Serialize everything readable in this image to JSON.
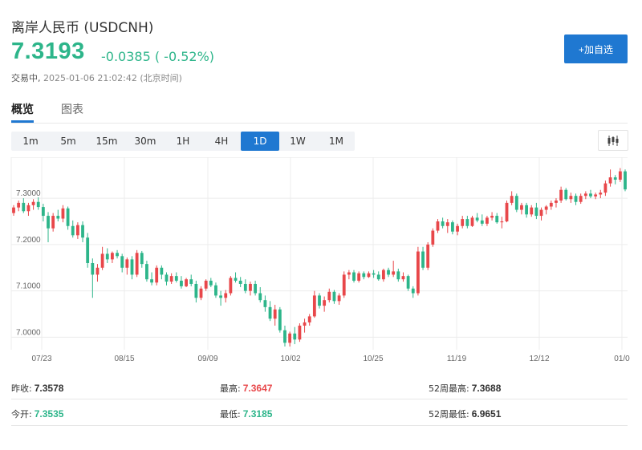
{
  "header": {
    "title": "离岸人民币  (USDCNH)",
    "price": "7.3193",
    "change": "-0.0385 ( -0.52%)",
    "status_label": "交易中,",
    "timestamp": "2025-01-06 21:02:42 (北京时间)",
    "watch_button": "+加自选"
  },
  "tabs": [
    {
      "label": "概览",
      "active": true
    },
    {
      "label": "图表",
      "active": false
    }
  ],
  "timeframes": [
    {
      "label": "1m",
      "active": false
    },
    {
      "label": "5m",
      "active": false
    },
    {
      "label": "15m",
      "active": false
    },
    {
      "label": "30m",
      "active": false
    },
    {
      "label": "1H",
      "active": false
    },
    {
      "label": "4H",
      "active": false
    },
    {
      "label": "1D",
      "active": true
    },
    {
      "label": "1W",
      "active": false
    },
    {
      "label": "1M",
      "active": false
    }
  ],
  "chart_type_icon": "candlestick-icon",
  "colors": {
    "up": "#e8474a",
    "down": "#2db58a",
    "accent": "#1f78d1",
    "grid": "#ececec"
  },
  "chart_data": {
    "type": "candlestick",
    "title": "",
    "xlabel": "",
    "ylabel": "",
    "ylim": [
      6.973,
      7.385
    ],
    "y_ticks": [
      "7.0000",
      "7.1000",
      "7.2000",
      "7.3000"
    ],
    "x_tick_labels": [
      "07/23",
      "08/15",
      "09/09",
      "10/02",
      "10/25",
      "11/19",
      "12/12",
      "01/0"
    ],
    "grid": true,
    "candles": [
      [
        7.268,
        7.285,
        7.262,
        7.28
      ],
      [
        7.28,
        7.295,
        7.272,
        7.29
      ],
      [
        7.29,
        7.3,
        7.268,
        7.272
      ],
      [
        7.272,
        7.29,
        7.262,
        7.285
      ],
      [
        7.285,
        7.298,
        7.275,
        7.292
      ],
      [
        7.292,
        7.302,
        7.275,
        7.281
      ],
      [
        7.281,
        7.288,
        7.25,
        7.262
      ],
      [
        7.262,
        7.27,
        7.205,
        7.235
      ],
      [
        7.235,
        7.268,
        7.228,
        7.262
      ],
      [
        7.262,
        7.275,
        7.25,
        7.256
      ],
      [
        7.256,
        7.285,
        7.248,
        7.278
      ],
      [
        7.278,
        7.282,
        7.232,
        7.24
      ],
      [
        7.24,
        7.252,
        7.215,
        7.22
      ],
      [
        7.22,
        7.248,
        7.212,
        7.242
      ],
      [
        7.242,
        7.25,
        7.205,
        7.215
      ],
      [
        7.215,
        7.225,
        7.15,
        7.16
      ],
      [
        7.16,
        7.17,
        7.085,
        7.135
      ],
      [
        7.135,
        7.158,
        7.12,
        7.15
      ],
      [
        7.15,
        7.195,
        7.145,
        7.18
      ],
      [
        7.18,
        7.192,
        7.16,
        7.168
      ],
      [
        7.168,
        7.185,
        7.16,
        7.182
      ],
      [
        7.182,
        7.188,
        7.17,
        7.175
      ],
      [
        7.175,
        7.18,
        7.14,
        7.15
      ],
      [
        7.15,
        7.172,
        7.135,
        7.168
      ],
      [
        7.168,
        7.175,
        7.125,
        7.135
      ],
      [
        7.135,
        7.188,
        7.13,
        7.182
      ],
      [
        7.182,
        7.186,
        7.15,
        7.158
      ],
      [
        7.158,
        7.165,
        7.12,
        7.125
      ],
      [
        7.125,
        7.14,
        7.112,
        7.118
      ],
      [
        7.118,
        7.155,
        7.112,
        7.15
      ],
      [
        7.15,
        7.155,
        7.125,
        7.135
      ],
      [
        7.135,
        7.14,
        7.112,
        7.12
      ],
      [
        7.12,
        7.138,
        7.115,
        7.132
      ],
      [
        7.132,
        7.14,
        7.118,
        7.122
      ],
      [
        7.122,
        7.132,
        7.105,
        7.11
      ],
      [
        7.11,
        7.128,
        7.108,
        7.125
      ],
      [
        7.125,
        7.135,
        7.11,
        7.115
      ],
      [
        7.115,
        7.122,
        7.075,
        7.085
      ],
      [
        7.085,
        7.11,
        7.08,
        7.105
      ],
      [
        7.105,
        7.125,
        7.1,
        7.122
      ],
      [
        7.122,
        7.128,
        7.108,
        7.112
      ],
      [
        7.112,
        7.118,
        7.085,
        7.09
      ],
      [
        7.09,
        7.1,
        7.068,
        7.085
      ],
      [
        7.085,
        7.102,
        7.075,
        7.095
      ],
      [
        7.095,
        7.132,
        7.09,
        7.128
      ],
      [
        7.128,
        7.14,
        7.118,
        7.122
      ],
      [
        7.122,
        7.13,
        7.108,
        7.115
      ],
      [
        7.115,
        7.125,
        7.095,
        7.1
      ],
      [
        7.1,
        7.12,
        7.09,
        7.115
      ],
      [
        7.115,
        7.122,
        7.09,
        7.095
      ],
      [
        7.095,
        7.108,
        7.075,
        7.08
      ],
      [
        7.08,
        7.09,
        7.055,
        7.065
      ],
      [
        7.065,
        7.078,
        7.035,
        7.04
      ],
      [
        7.04,
        7.07,
        7.025,
        7.06
      ],
      [
        7.06,
        7.065,
        7.01,
        7.015
      ],
      [
        7.015,
        7.025,
        6.98,
        6.988
      ],
      [
        6.988,
        7.012,
        6.98,
        7.008
      ],
      [
        7.008,
        7.022,
        6.985,
        6.995
      ],
      [
        6.995,
        7.03,
        6.99,
        7.025
      ],
      [
        7.025,
        7.04,
        7.01,
        7.032
      ],
      [
        7.032,
        7.05,
        7.025,
        7.045
      ],
      [
        7.045,
        7.1,
        7.042,
        7.09
      ],
      [
        7.09,
        7.095,
        7.062,
        7.068
      ],
      [
        7.068,
        7.088,
        7.055,
        7.08
      ],
      [
        7.08,
        7.105,
        7.075,
        7.098
      ],
      [
        7.098,
        7.102,
        7.072,
        7.078
      ],
      [
        7.078,
        7.095,
        7.07,
        7.09
      ],
      [
        7.09,
        7.142,
        7.085,
        7.135
      ],
      [
        7.135,
        7.145,
        7.125,
        7.14
      ],
      [
        7.14,
        7.145,
        7.118,
        7.122
      ],
      [
        7.122,
        7.142,
        7.118,
        7.138
      ],
      [
        7.138,
        7.142,
        7.125,
        7.13
      ],
      [
        7.13,
        7.142,
        7.128,
        7.138
      ],
      [
        7.138,
        7.145,
        7.128,
        7.135
      ],
      [
        7.135,
        7.142,
        7.122,
        7.125
      ],
      [
        7.125,
        7.148,
        7.12,
        7.145
      ],
      [
        7.145,
        7.15,
        7.13,
        7.135
      ],
      [
        7.135,
        7.165,
        7.13,
        7.142
      ],
      [
        7.142,
        7.148,
        7.12,
        7.125
      ],
      [
        7.125,
        7.14,
        7.12,
        7.132
      ],
      [
        7.132,
        7.135,
        7.1,
        7.105
      ],
      [
        7.105,
        7.11,
        7.085,
        7.095
      ],
      [
        7.095,
        7.195,
        7.09,
        7.185
      ],
      [
        7.185,
        7.195,
        7.145,
        7.15
      ],
      [
        7.15,
        7.205,
        7.145,
        7.2
      ],
      [
        7.2,
        7.235,
        7.195,
        7.23
      ],
      [
        7.23,
        7.255,
        7.225,
        7.25
      ],
      [
        7.25,
        7.258,
        7.235,
        7.24
      ],
      [
        7.24,
        7.255,
        7.225,
        7.248
      ],
      [
        7.248,
        7.252,
        7.222,
        7.228
      ],
      [
        7.228,
        7.245,
        7.22,
        7.24
      ],
      [
        7.24,
        7.262,
        7.235,
        7.255
      ],
      [
        7.255,
        7.262,
        7.235,
        7.24
      ],
      [
        7.24,
        7.262,
        7.238,
        7.258
      ],
      [
        7.258,
        7.268,
        7.248,
        7.252
      ],
      [
        7.252,
        7.265,
        7.24,
        7.245
      ],
      [
        7.245,
        7.262,
        7.24,
        7.258
      ],
      [
        7.258,
        7.27,
        7.252,
        7.262
      ],
      [
        7.262,
        7.268,
        7.245,
        7.248
      ],
      [
        7.248,
        7.26,
        7.235,
        7.25
      ],
      [
        7.25,
        7.295,
        7.248,
        7.29
      ],
      [
        7.29,
        7.315,
        7.285,
        7.305
      ],
      [
        7.305,
        7.31,
        7.27,
        7.275
      ],
      [
        7.275,
        7.29,
        7.265,
        7.285
      ],
      [
        7.285,
        7.29,
        7.258,
        7.265
      ],
      [
        7.265,
        7.285,
        7.26,
        7.28
      ],
      [
        7.28,
        7.29,
        7.255,
        7.262
      ],
      [
        7.262,
        7.28,
        7.252,
        7.275
      ],
      [
        7.275,
        7.285,
        7.265,
        7.282
      ],
      [
        7.282,
        7.295,
        7.275,
        7.29
      ],
      [
        7.29,
        7.3,
        7.28,
        7.295
      ],
      [
        7.295,
        7.325,
        7.29,
        7.318
      ],
      [
        7.318,
        7.322,
        7.295,
        7.298
      ],
      [
        7.298,
        7.312,
        7.29,
        7.305
      ],
      [
        7.305,
        7.31,
        7.285,
        7.292
      ],
      [
        7.292,
        7.31,
        7.288,
        7.305
      ],
      [
        7.305,
        7.315,
        7.298,
        7.31
      ],
      [
        7.31,
        7.318,
        7.3,
        7.304
      ],
      [
        7.304,
        7.312,
        7.298,
        7.308
      ],
      [
        7.308,
        7.318,
        7.3,
        7.312
      ],
      [
        7.312,
        7.338,
        7.305,
        7.332
      ],
      [
        7.332,
        7.362,
        7.325,
        7.345
      ],
      [
        7.345,
        7.35,
        7.33,
        7.34
      ],
      [
        7.34,
        7.365,
        7.335,
        7.358
      ],
      [
        7.358,
        7.362,
        7.315,
        7.319
      ]
    ]
  },
  "stats": [
    {
      "label": "昨收:",
      "value": "7.3578",
      "tone": "neutral"
    },
    {
      "label": "最高:",
      "value": "7.3647",
      "tone": "red"
    },
    {
      "label": "52周最高:",
      "value": "7.3688",
      "tone": "neutral"
    },
    {
      "label": "今开:",
      "value": "7.3535",
      "tone": "green"
    },
    {
      "label": "最低:",
      "value": "7.3185",
      "tone": "green"
    },
    {
      "label": "52周最低:",
      "value": "6.9651",
      "tone": "neutral"
    }
  ]
}
